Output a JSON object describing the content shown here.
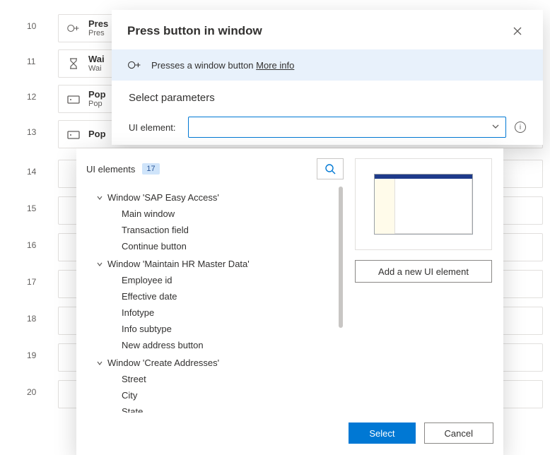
{
  "steps": [
    {
      "num": "10",
      "title": "Pres",
      "sub": "Pres",
      "icon": "press"
    },
    {
      "num": "11",
      "title": "Wai",
      "sub": "Wai",
      "icon": "hourglass"
    },
    {
      "num": "12",
      "title": "Pop",
      "sub": "Pop",
      "icon": "popup"
    },
    {
      "num": "13",
      "title": "Pop",
      "sub": "",
      "icon": "popup"
    },
    {
      "num": "14",
      "title": "",
      "sub": "",
      "icon": ""
    },
    {
      "num": "15",
      "title": "",
      "sub": "",
      "icon": ""
    },
    {
      "num": "16",
      "title": "",
      "sub": "",
      "icon": ""
    },
    {
      "num": "17",
      "title": "",
      "sub": "",
      "icon": ""
    },
    {
      "num": "18",
      "title": "",
      "sub": "",
      "icon": ""
    },
    {
      "num": "19",
      "title": "",
      "sub": "",
      "icon": ""
    },
    {
      "num": "20",
      "title": "",
      "sub": "",
      "icon": ""
    }
  ],
  "modal": {
    "title": "Press button in window",
    "banner_text": "Presses a window button",
    "more_info": "More info",
    "params_heading": "Select parameters",
    "param_label": "UI element:"
  },
  "popup": {
    "heading": "UI elements",
    "count": "17",
    "groups": [
      {
        "name": "Window 'SAP Easy Access'",
        "items": [
          "Main window",
          "Transaction field",
          "Continue button"
        ]
      },
      {
        "name": "Window 'Maintain HR Master Data'",
        "items": [
          "Employee id",
          "Effective date",
          "Infotype",
          "Info subtype",
          "New address button"
        ]
      },
      {
        "name": "Window 'Create Addresses'",
        "items": [
          "Street",
          "City",
          "State"
        ]
      }
    ],
    "add_label": "Add a new UI element",
    "select": "Select",
    "cancel": "Cancel"
  }
}
